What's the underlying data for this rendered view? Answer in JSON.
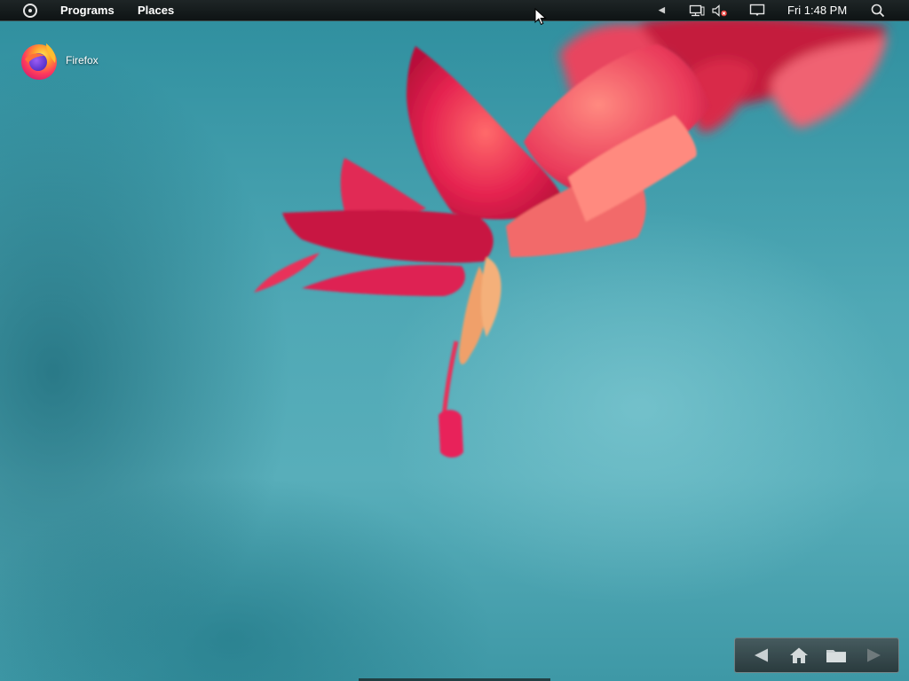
{
  "panel": {
    "menus": {
      "programs_label": "Programs",
      "places_label": "Places"
    },
    "tray": {
      "clock_text": "Fri 1:48 PM"
    }
  },
  "desktop": {
    "icons": [
      {
        "label": "Firefox",
        "icon": "firefox-icon"
      }
    ]
  },
  "dock": {
    "buttons": [
      "back-arrow-icon",
      "home-icon",
      "folder-icon",
      "forward-arrow-icon"
    ]
  },
  "colors": {
    "panel_bg": "#0e1314",
    "wallpaper_teal": "#4fa8b5",
    "flower_red": "#e0294f",
    "panel_text": "#ffffff"
  }
}
